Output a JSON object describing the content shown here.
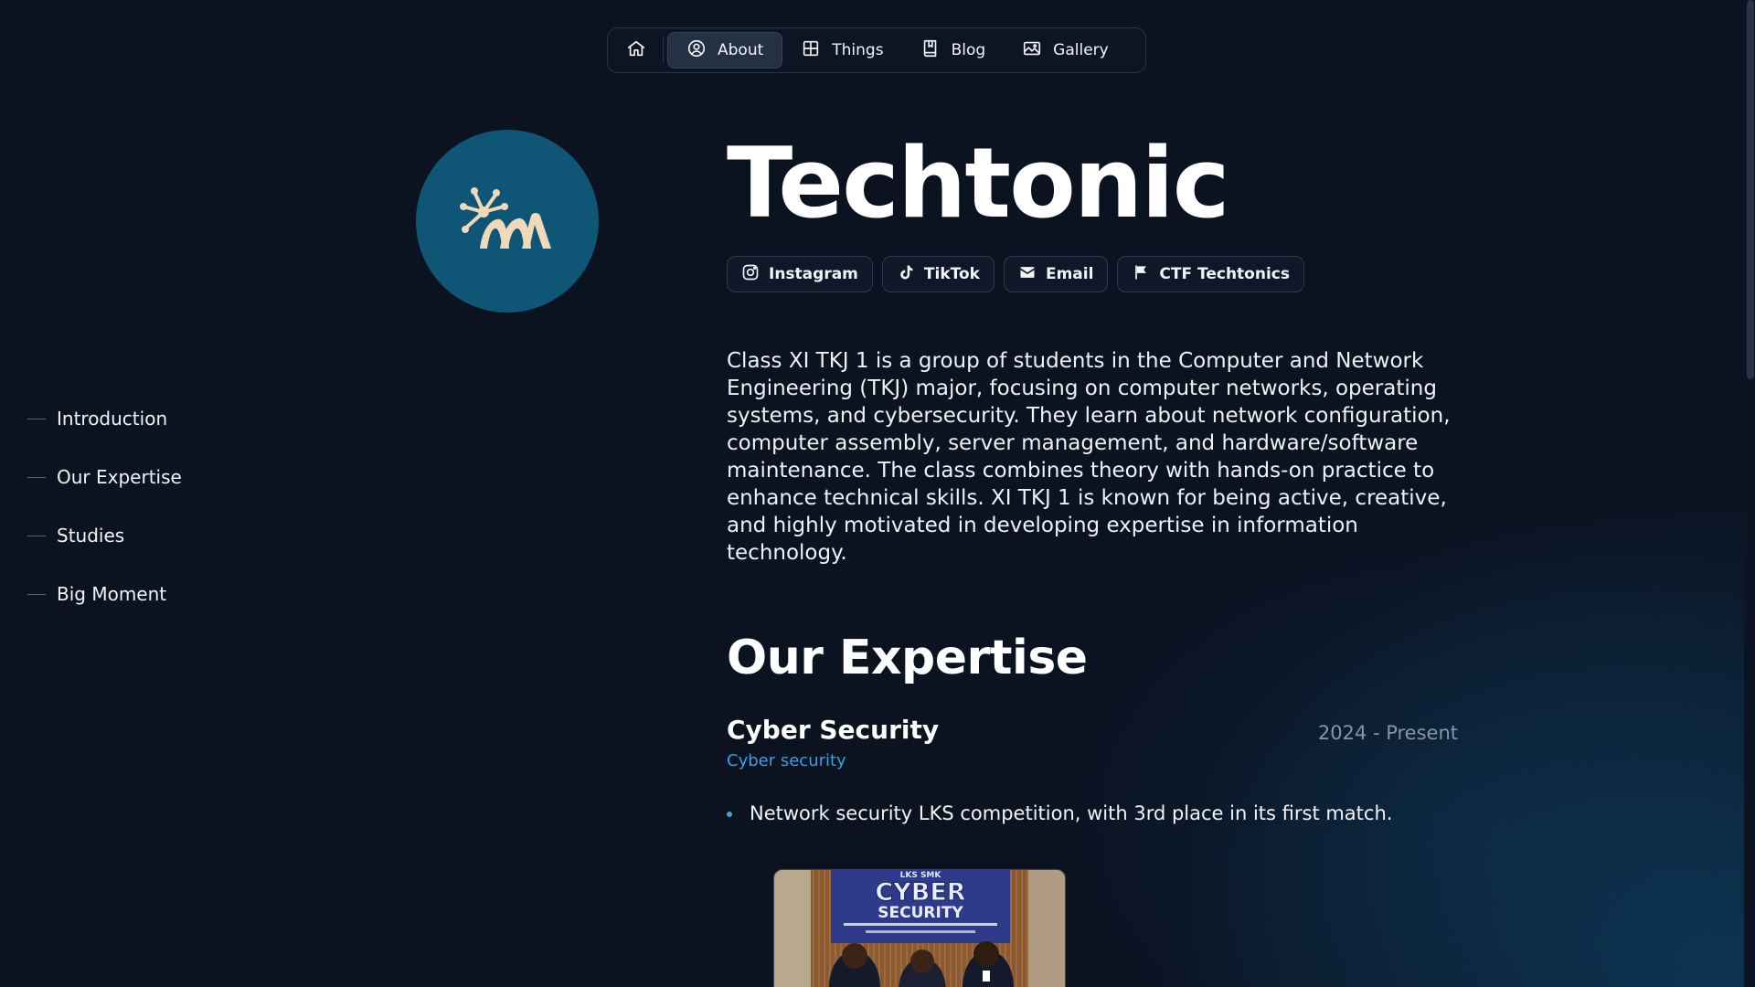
{
  "nav": {
    "items": [
      {
        "label": "About"
      },
      {
        "label": "Things"
      },
      {
        "label": "Blog"
      },
      {
        "label": "Gallery"
      }
    ]
  },
  "toc": {
    "items": [
      {
        "label": "Introduction"
      },
      {
        "label": "Our Expertise"
      },
      {
        "label": "Studies"
      },
      {
        "label": "Big Moment"
      }
    ]
  },
  "profile": {
    "name": "Techtonic",
    "avatar_color": "#0f5576",
    "socials": [
      {
        "label": "Instagram",
        "icon": "instagram-icon"
      },
      {
        "label": "TikTok",
        "icon": "tiktok-icon"
      },
      {
        "label": "Email",
        "icon": "email-icon"
      },
      {
        "label": "CTF Techtonics",
        "icon": "flag-icon"
      }
    ],
    "intro": "Class XI TKJ 1 is a group of students in the Computer and Network Engineering (TKJ) major, focusing on computer networks, operating systems, and cybersecurity. They learn about network configuration, computer assembly, server management, and hardware/software maintenance. The class combines theory with hands-on practice to enhance technical skills. XI TKJ 1 is known for being active, creative, and highly motivated in developing expertise in information technology."
  },
  "expertise": {
    "title": "Our Expertise",
    "items": [
      {
        "name": "Cyber Security",
        "subtitle": "Cyber security",
        "period": "2024 - Present",
        "bullets": [
          "Network security LKS competition, with 3rd place in its first match."
        ],
        "photo_banner": {
          "top": "LKS SMK",
          "main1": "CYBER",
          "main2": "SECURITY"
        }
      }
    ]
  },
  "colors": {
    "accent": "#3aa0e0",
    "background": "#0b1220"
  }
}
